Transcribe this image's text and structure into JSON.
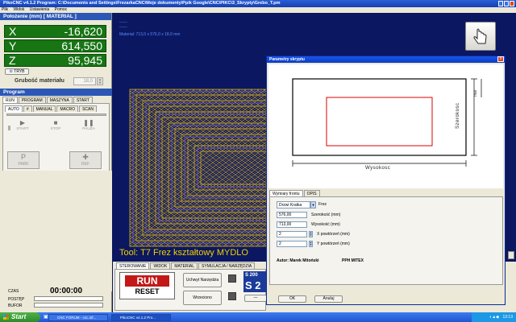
{
  "window": {
    "title": "PikoCNC v4.1.2    Program: C:\\Documents and Settings\\FrezarkaCNC\\Moje dokumenty\\Ppik Google\\CNC\\PIKC\\3_Skrypty\\Grebo_T.pm"
  },
  "menu": [
    "Plik",
    "Widok",
    "Ustawienia",
    "Pomoc"
  ],
  "position": {
    "title": "Położenie (mm) [ MATERIAL ]",
    "axes": [
      {
        "label": "X",
        "value": "-16,620"
      },
      {
        "label": "Y",
        "value": "614,550"
      },
      {
        "label": "Z",
        "value": "95,945"
      }
    ],
    "tryb_label": "TRYB",
    "thickness_label": "Grubość materiału",
    "thickness_value": "18,0"
  },
  "program": {
    "title": "Program",
    "tabs": [
      "RUN",
      "PROGRAM",
      "MASZYNA",
      "START"
    ],
    "subtabs": [
      "AUTO",
      "#",
      "MANUAL",
      "MACRO",
      "SCAN"
    ],
    "controls": [
      {
        "label": "START",
        "icon": "▶"
      },
      {
        "label": "STOP",
        "icon": "■"
      },
      {
        "label": "PAUZA",
        "icon": "❚❚"
      }
    ],
    "park_label": "PARK",
    "park_icon": "P",
    "ref_label": "REF",
    "ref_icon": "✚"
  },
  "status": {
    "czas_label": "CZAS",
    "czas_value": "00:00:00",
    "postep_label": "POSTĘP",
    "bufor_label": "BUFOR"
  },
  "canvas": {
    "header_dash1": "------",
    "header_dash2": "------",
    "material_text": "Materiał: 713,0 x 576,0 x 18,0 mm",
    "tool_text": "Tool: T7 Frez kształtowy MYDLO"
  },
  "bottom": {
    "tabs": [
      "STEROWANIE",
      "WIDOK",
      "MATERIAL",
      "SYMULACJA / NARZĘDZIA"
    ],
    "run_label": "RUN",
    "reset_label": "RESET",
    "uchwyt_label": "Uchwyt Narzędzia",
    "wrzeciono_label": "Wrzeciono",
    "s_small": "S 200",
    "s_big": "S 2"
  },
  "dialog": {
    "title": "Parametry skryptu",
    "close": "x",
    "drawing": {
      "width_label": "Wysokosc",
      "height_label": "Szerokosc",
      "margin_label": "mar"
    },
    "tabs": [
      "Wymiary frontu",
      "OPIS"
    ],
    "type_value": "Drzwi Kratka",
    "type_label": "Frez",
    "fields": [
      {
        "value": "576,00",
        "label": "Szerokość (mm)",
        "spin": false
      },
      {
        "value": "713,00",
        "label": "Wysokość (mm)",
        "spin": false
      },
      {
        "value": "2",
        "label": "X powtórzeń (mm)",
        "spin": true
      },
      {
        "value": "2",
        "label": "Y powtórzeń (mm)",
        "spin": true
      }
    ],
    "author": "Autor: Marek Mitoński",
    "company": "PPH MITEX",
    "ok_label": "OK",
    "cancel_label": "Anuluj"
  },
  "taskbar": {
    "start_label": "Start",
    "tasks": [
      "CNC FORUM - cnc.inf...",
      "PikoCNC v4.1.2    Pro..."
    ],
    "clock": "13:13"
  }
}
